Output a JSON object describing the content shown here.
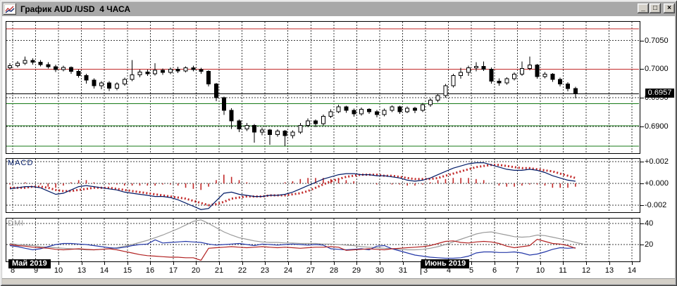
{
  "window": {
    "title": "График AUD /USD  4 ЧАСА",
    "controls": [
      {
        "name": "minimize",
        "glyph": "_"
      },
      {
        "name": "maximize",
        "glyph": "□"
      },
      {
        "name": "close",
        "glyph": "×"
      }
    ]
  },
  "panes": {
    "macd_label": "MACD",
    "dmi_label": "DMI"
  },
  "x_axis": {
    "dates": [
      "8",
      "9",
      "10",
      "13",
      "14",
      "15",
      "16",
      "17",
      "20",
      "21",
      "22",
      "23",
      "24",
      "27",
      "28",
      "29",
      "30",
      "31",
      "3",
      "4",
      "5",
      "6",
      "7",
      "10",
      "11",
      "12",
      "13",
      "14"
    ],
    "months": [
      {
        "label": "Май 2019",
        "at_index": 0
      },
      {
        "label": "Июнь 2019",
        "at_index": 18
      }
    ]
  },
  "chart_data": [
    {
      "type": "candlestick",
      "title": "AUD/USD 4 часа",
      "ylim": [
        0.6852,
        0.7052
      ],
      "grid": true,
      "grid_levels": [
        0.705,
        0.7,
        0.695,
        0.69
      ],
      "y_labels": [
        {
          "text": "0.7050",
          "value": 0.705
        },
        {
          "text": "0.7000",
          "value": 0.7
        },
        {
          "text": "0.6950",
          "value": 0.695
        },
        {
          "text": "0.6900",
          "value": 0.69
        }
      ],
      "current_price": {
        "text": "0.6957",
        "value": 0.6957
      },
      "hlines": [
        {
          "value": 0.707,
          "color": "#c22a2a"
        },
        {
          "value": 0.7,
          "color": "#c22a2a"
        },
        {
          "value": 0.694,
          "color": "#177a17"
        },
        {
          "value": 0.6901,
          "color": "#177a17"
        },
        {
          "value": 0.6866,
          "color": "#177a17"
        },
        {
          "value": 0.6957,
          "color": "#000000"
        }
      ],
      "candles": [
        [
          0.7002,
          0.701,
          0.6999,
          0.7006
        ],
        [
          0.7006,
          0.7014,
          0.7003,
          0.701
        ],
        [
          0.701,
          0.7022,
          0.7007,
          0.7015
        ],
        [
          0.7015,
          0.7019,
          0.7008,
          0.7012
        ],
        [
          0.7012,
          0.7016,
          0.7005,
          0.7008
        ],
        [
          0.7008,
          0.7012,
          0.7001,
          0.7004
        ],
        [
          0.7004,
          0.7008,
          0.6995,
          0.6999
        ],
        [
          0.6999,
          0.7006,
          0.6996,
          0.7003
        ],
        [
          0.7003,
          0.7005,
          0.6992,
          0.6996
        ],
        [
          0.6996,
          0.6999,
          0.6985,
          0.6989
        ],
        [
          0.6989,
          0.6992,
          0.6975,
          0.6981
        ],
        [
          0.6981,
          0.6984,
          0.6966,
          0.6971
        ],
        [
          0.6971,
          0.6979,
          0.6965,
          0.6976
        ],
        [
          0.6976,
          0.6979,
          0.6962,
          0.6967
        ],
        [
          0.6967,
          0.6977,
          0.6963,
          0.6974
        ],
        [
          0.6974,
          0.6985,
          0.6971,
          0.6982
        ],
        [
          0.6982,
          0.7016,
          0.6979,
          0.699
        ],
        [
          0.699,
          0.6999,
          0.6986,
          0.6995
        ],
        [
          0.6995,
          0.6999,
          0.6988,
          0.6992
        ],
        [
          0.6992,
          0.701,
          0.6989,
          0.6998
        ],
        [
          0.6998,
          0.7001,
          0.699,
          0.6994
        ],
        [
          0.6994,
          0.7003,
          0.6991,
          0.7
        ],
        [
          0.7,
          0.7004,
          0.6993,
          0.6997
        ],
        [
          0.6997,
          0.7005,
          0.6994,
          0.7002
        ],
        [
          0.7002,
          0.7006,
          0.6996,
          0.6999
        ],
        [
          0.6999,
          0.7002,
          0.6992,
          0.6996
        ],
        [
          0.6996,
          0.6998,
          0.697,
          0.6974
        ],
        [
          0.6974,
          0.6976,
          0.6944,
          0.695
        ],
        [
          0.695,
          0.6952,
          0.692,
          0.6928
        ],
        [
          0.6928,
          0.6932,
          0.6896,
          0.691
        ],
        [
          0.691,
          0.6912,
          0.689,
          0.6896
        ],
        [
          0.6896,
          0.6906,
          0.6892,
          0.6902
        ],
        [
          0.6902,
          0.6904,
          0.6872,
          0.689
        ],
        [
          0.689,
          0.6898,
          0.6885,
          0.6894
        ],
        [
          0.6894,
          0.6896,
          0.6868,
          0.6886
        ],
        [
          0.6886,
          0.6895,
          0.6882,
          0.6892
        ],
        [
          0.6892,
          0.6894,
          0.6866,
          0.6884
        ],
        [
          0.6884,
          0.6893,
          0.6879,
          0.689
        ],
        [
          0.689,
          0.6906,
          0.6887,
          0.6902
        ],
        [
          0.6902,
          0.6914,
          0.6899,
          0.691
        ],
        [
          0.691,
          0.6912,
          0.6899,
          0.6905
        ],
        [
          0.6905,
          0.6921,
          0.6902,
          0.6918
        ],
        [
          0.6918,
          0.693,
          0.6915,
          0.6926
        ],
        [
          0.6926,
          0.6938,
          0.6923,
          0.6934
        ],
        [
          0.6934,
          0.6936,
          0.6924,
          0.6928
        ],
        [
          0.6928,
          0.6931,
          0.6917,
          0.6922
        ],
        [
          0.6922,
          0.6933,
          0.6919,
          0.693
        ],
        [
          0.693,
          0.6932,
          0.6922,
          0.6926
        ],
        [
          0.6926,
          0.6929,
          0.6916,
          0.6921
        ],
        [
          0.6921,
          0.6931,
          0.6918,
          0.6928
        ],
        [
          0.6928,
          0.6937,
          0.6925,
          0.6934
        ],
        [
          0.6934,
          0.6936,
          0.6922,
          0.6926
        ],
        [
          0.6926,
          0.6935,
          0.6923,
          0.6932
        ],
        [
          0.6932,
          0.6934,
          0.6923,
          0.6928
        ],
        [
          0.6928,
          0.6941,
          0.6925,
          0.6938
        ],
        [
          0.6938,
          0.6949,
          0.6934,
          0.6946
        ],
        [
          0.6946,
          0.6957,
          0.6942,
          0.6954
        ],
        [
          0.6954,
          0.6974,
          0.695,
          0.6971
        ],
        [
          0.6971,
          0.6992,
          0.6968,
          0.6989
        ],
        [
          0.6989,
          0.7002,
          0.6983,
          0.6994
        ],
        [
          0.6994,
          0.7006,
          0.6988,
          0.7002
        ],
        [
          0.7002,
          0.7012,
          0.6996,
          0.7005
        ],
        [
          0.7005,
          0.7013,
          0.6997,
          0.7
        ],
        [
          0.7,
          0.7003,
          0.6975,
          0.6979
        ],
        [
          0.6979,
          0.6984,
          0.6971,
          0.6976
        ],
        [
          0.6976,
          0.6986,
          0.6973,
          0.6983
        ],
        [
          0.6983,
          0.6994,
          0.698,
          0.6991
        ],
        [
          0.6991,
          0.7013,
          0.6988,
          0.7001
        ],
        [
          0.7001,
          0.7022,
          0.6998,
          0.7007
        ],
        [
          0.7007,
          0.7009,
          0.6983,
          0.6987
        ],
        [
          0.6987,
          0.6995,
          0.6984,
          0.6991
        ],
        [
          0.6991,
          0.6993,
          0.6978,
          0.6982
        ],
        [
          0.6982,
          0.6985,
          0.697,
          0.6974
        ],
        [
          0.6974,
          0.6977,
          0.6961,
          0.6966
        ],
        [
          0.6966,
          0.6969,
          0.6949,
          0.6957
        ]
      ]
    },
    {
      "type": "line",
      "title": "MACD",
      "ylim": [
        -0.0026,
        0.0023
      ],
      "grid_levels": [
        0.002,
        0,
        -0.002
      ],
      "y_labels": [
        {
          "text": "+0.002",
          "value": 0.002
        },
        {
          "text": "+0.000",
          "value": 0
        },
        {
          "text": "-0.002",
          "value": -0.002
        }
      ],
      "colors": {
        "macd": "#001a66",
        "signal": "#c22a2a",
        "histogram": "#c22a2a"
      },
      "macd": [
        -0.0005,
        -0.0004,
        -0.0003,
        -0.0003,
        -0.0004,
        -0.0007,
        -0.001,
        -0.0009,
        -0.0006,
        -0.0003,
        -0.0002,
        -0.0003,
        -0.0004,
        -0.0005,
        -0.0006,
        -0.0008,
        -0.0009,
        -0.001,
        -0.0011,
        -0.0012,
        -0.0012,
        -0.0013,
        -0.0015,
        -0.0018,
        -0.0021,
        -0.0024,
        -0.0023,
        -0.0016,
        -0.0009,
        -0.0008,
        -0.001,
        -0.0011,
        -0.0012,
        -0.0012,
        -0.0011,
        -0.0011,
        -0.001,
        -0.0008,
        -0.0005,
        -0.0002,
        0.0001,
        0.0004,
        0.0006,
        0.0008,
        0.0009,
        0.0009,
        0.0008,
        0.0008,
        0.0007,
        0.0007,
        0.0006,
        0.0005,
        0.0003,
        0.0002,
        0.0003,
        0.0005,
        0.0008,
        0.0011,
        0.0014,
        0.0016,
        0.0018,
        0.0019,
        0.0019,
        0.0017,
        0.0015,
        0.0013,
        0.0012,
        0.0012,
        0.0013,
        0.0012,
        0.001,
        0.0007,
        0.0005,
        0.0003,
        0.0002
      ],
      "signal": [
        -0.0004,
        -0.0004,
        -0.0004,
        -0.0003,
        -0.0003,
        -0.0004,
        -0.0006,
        -0.0007,
        -0.0007,
        -0.0006,
        -0.0005,
        -0.0004,
        -0.0004,
        -0.0004,
        -0.0005,
        -0.0006,
        -0.0007,
        -0.0008,
        -0.0009,
        -0.001,
        -0.0011,
        -0.0012,
        -0.0013,
        -0.0014,
        -0.0016,
        -0.0018,
        -0.002,
        -0.0019,
        -0.0017,
        -0.0014,
        -0.0013,
        -0.0012,
        -0.0012,
        -0.0012,
        -0.0011,
        -0.0011,
        -0.0011,
        -0.001,
        -0.0009,
        -0.0007,
        -0.0004,
        -0.0001,
        0.0002,
        0.0004,
        0.0006,
        0.0007,
        0.0008,
        0.0008,
        0.0008,
        0.0007,
        0.0007,
        0.0006,
        0.0005,
        0.0004,
        0.0004,
        0.0004,
        0.0005,
        0.0007,
        0.0009,
        0.0011,
        0.0013,
        0.0015,
        0.0016,
        0.0017,
        0.0017,
        0.0016,
        0.0015,
        0.0014,
        0.0014,
        0.0013,
        0.0012,
        0.0011,
        0.0009,
        0.0007,
        0.0005
      ]
    },
    {
      "type": "line",
      "title": "DMI",
      "ylim": [
        0,
        46
      ],
      "grid_levels": [
        40,
        20
      ],
      "y_labels": [
        {
          "text": "40",
          "value": 40
        },
        {
          "text": "20",
          "value": 20
        }
      ],
      "series": [
        {
          "name": "adx",
          "color": "#9a9a9a",
          "values": [
            21,
            20,
            19.5,
            19,
            18,
            17.5,
            17,
            16.5,
            16,
            15.5,
            15,
            15,
            15.5,
            16,
            17,
            18.5,
            20,
            22,
            24,
            26.5,
            29,
            32,
            35,
            38.5,
            42,
            43.5,
            40,
            36,
            32,
            29,
            26.5,
            25,
            23.5,
            22.5,
            22,
            22,
            21.5,
            21.5,
            21,
            21,
            21,
            20.5,
            20.5,
            20,
            19.5,
            19,
            18,
            17.5,
            17,
            16.5,
            16,
            15.5,
            15,
            15,
            15.5,
            16.5,
            18,
            20,
            22.5,
            25,
            27.5,
            30,
            31.5,
            32,
            30.5,
            29,
            27.5,
            27,
            27.5,
            29,
            28.5,
            27,
            25.5,
            24,
            22,
            20.5
          ]
        },
        {
          "name": "di-plus",
          "color": "#2438a8",
          "values": [
            19,
            18,
            16.5,
            15,
            16,
            18,
            20,
            21,
            21,
            20.5,
            20,
            19,
            18,
            17,
            16.5,
            17.5,
            19,
            20,
            20.5,
            24.5,
            21.5,
            22,
            22.5,
            23,
            22.5,
            22,
            20.5,
            19.5,
            20,
            20.5,
            21,
            20,
            19,
            20.5,
            20,
            19.5,
            20,
            20.5,
            20,
            19.5,
            20,
            19.5,
            16,
            15.5,
            15,
            15.5,
            16,
            15,
            18.5,
            19,
            16,
            14,
            12,
            10,
            9,
            8,
            7.5,
            7,
            7,
            7.5,
            9,
            12,
            13,
            13,
            12.5,
            12.5,
            13,
            12,
            10,
            11,
            13,
            15.5,
            17,
            16.5,
            17
          ]
        },
        {
          "name": "di-minus",
          "color": "#b22222",
          "values": [
            20,
            19,
            18.5,
            17.5,
            17,
            16.5,
            15.5,
            15,
            15.5,
            16,
            15.5,
            15,
            15.5,
            16,
            15,
            13.5,
            12,
            10.5,
            9.5,
            9,
            8.5,
            8,
            8,
            7.5,
            7.5,
            5,
            16.5,
            17,
            17.5,
            18,
            17.5,
            17,
            17.5,
            18,
            17.5,
            17,
            17.5,
            17,
            16.5,
            17,
            17.5,
            17.5,
            18,
            17.5,
            14.5,
            15,
            15.5,
            16,
            15.5,
            15,
            16,
            16.5,
            17,
            17.5,
            18,
            19,
            21,
            23,
            23.5,
            22,
            21.5,
            22.5,
            23,
            22.5,
            21,
            18.5,
            17,
            18,
            19,
            25,
            23,
            21,
            20.5,
            19,
            16.5
          ]
        }
      ]
    }
  ]
}
